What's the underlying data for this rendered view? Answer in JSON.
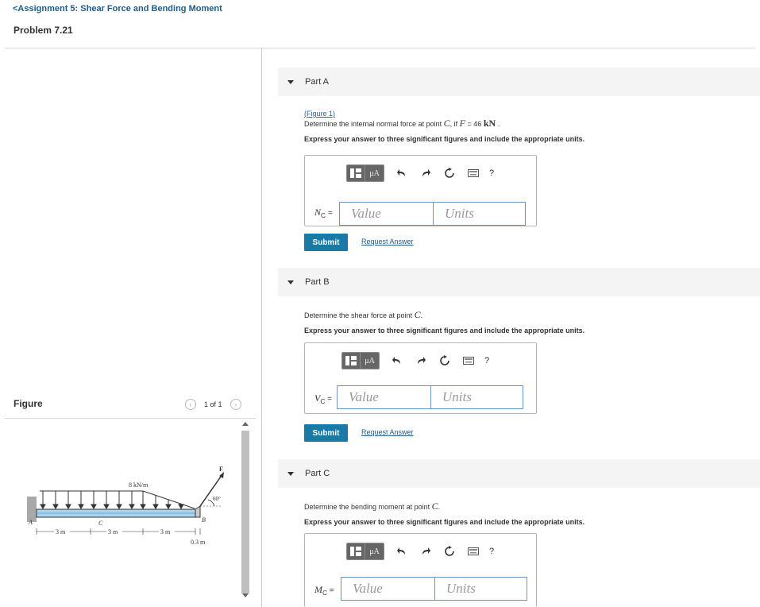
{
  "header": {
    "back_label": "<Assignment 5: Shear Force and Bending Moment",
    "problem_title": "Problem 7.21"
  },
  "figure_pane": {
    "label": "Figure",
    "counter": "1 of 1",
    "prev_icon": "chevron-left-icon",
    "next_icon": "chevron-right-icon",
    "diagram": {
      "load_label": "8 kN/m",
      "force_label": "F",
      "angle_label": "60°",
      "point_a": "A",
      "point_b": "B",
      "point_c": "C",
      "dim1": "3 m",
      "dim2": "3 m",
      "dim3": "3 m",
      "dim4": "0.3 m"
    }
  },
  "toolbar": {
    "template_icon": "template-grid-icon",
    "mu_label": "μA",
    "undo_icon": "undo-icon",
    "redo_icon": "redo-icon",
    "reset_icon": "reset-icon",
    "keyboard_icon": "keyboard-icon",
    "help_label": "?"
  },
  "parts": [
    {
      "title": "Part A",
      "figure_link": "(Figure 1)",
      "question_prefix": "Determine the internal normal force at point",
      "question_point": "C",
      "question_mid": ", if",
      "question_var": "F",
      "question_eq": "= 46",
      "question_unit": "kN",
      "question_end": ".",
      "instruction": "Express your answer to three significant figures and include the appropriate units.",
      "var_symbol": "N",
      "var_sub": "C",
      "var_eq": "=",
      "value_placeholder": "Value",
      "units_placeholder": "Units",
      "submit_label": "Submit",
      "request_label": "Request Answer"
    },
    {
      "title": "Part B",
      "question_prefix": "Determine the shear force at point",
      "question_point": "C",
      "question_end": ".",
      "instruction": "Express your answer to three significant figures and include the appropriate units.",
      "var_symbol": "V",
      "var_sub": "C",
      "var_eq": "=",
      "value_placeholder": "Value",
      "units_placeholder": "Units",
      "submit_label": "Submit",
      "request_label": "Request Answer"
    },
    {
      "title": "Part C",
      "question_prefix": "Determine the bending moment at point",
      "question_point": "C",
      "question_end": ".",
      "instruction": "Express your answer to three significant figures and include the appropriate units.",
      "var_symbol": "M",
      "var_sub": "C",
      "var_eq": "=",
      "value_placeholder": "Value",
      "units_placeholder": "Units"
    }
  ]
}
